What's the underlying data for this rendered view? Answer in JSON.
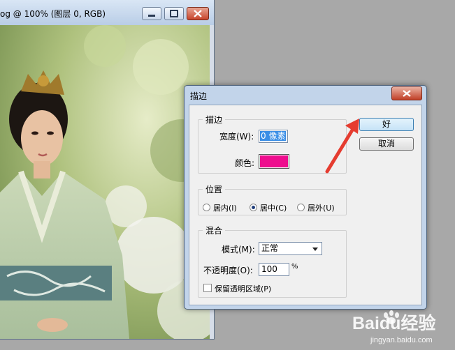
{
  "colors": {
    "stroke_color": "#ee0d8e",
    "arrow": "#e53c30",
    "accent_button": "#c6e3f7"
  },
  "document": {
    "title": "og @ 100% (图层 0, RGB)"
  },
  "dialog": {
    "title": "描边",
    "stroke_group": {
      "legend": "描边",
      "width_label": "宽度(W):",
      "width_value": "0 像素",
      "color_label": "颜色:"
    },
    "position_group": {
      "legend": "位置",
      "options": [
        "居内(I)",
        "居中(C)",
        "居外(U)"
      ],
      "selected": "居中(C)"
    },
    "blend_group": {
      "legend": "混合",
      "mode_label": "模式(M):",
      "mode_value": "正常",
      "opacity_label": "不透明度(O):",
      "opacity_value": "100",
      "opacity_unit": "%",
      "preserve_label": "保留透明区域(P)",
      "preserve_checked": false
    },
    "buttons": {
      "ok": "好",
      "cancel": "取消"
    }
  },
  "watermark": {
    "brand": "Baidu经验",
    "url": "jingyan.baidu.com"
  }
}
